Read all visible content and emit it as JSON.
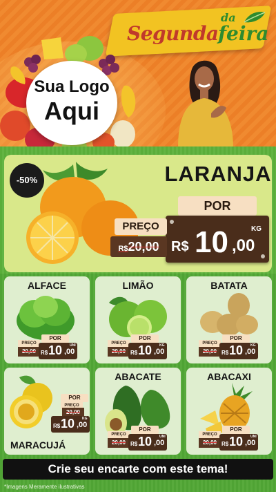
{
  "header": {
    "banner_part1": "Segunda",
    "banner_part2": "da",
    "banner_part3": "feira",
    "logo_line1": "Sua Logo",
    "logo_line2": "Aqui"
  },
  "hero": {
    "discount": "-50%",
    "product": "LARANJA",
    "por_label": "POR",
    "preco_label": "PREÇO",
    "old_currency": "R$",
    "old_price": "20,00",
    "currency": "R$",
    "price_int": "10",
    "price_dec": ",00",
    "unit": "KG"
  },
  "products": [
    {
      "name": "ALFACE",
      "preco_label": "PREÇO",
      "por_label": "POR",
      "old_price": "20,00",
      "currency": "R$",
      "price_int": "10",
      "price_dec": ",00",
      "unit": "UNI"
    },
    {
      "name": "LIMÃO",
      "preco_label": "PREÇO",
      "por_label": "POR",
      "old_price": "20,00",
      "currency": "R$",
      "price_int": "10",
      "price_dec": ",00",
      "unit": "KG"
    },
    {
      "name": "BATATA",
      "preco_label": "PREÇO",
      "por_label": "POR",
      "old_price": "20,00",
      "currency": "R$",
      "price_int": "10",
      "price_dec": ",00",
      "unit": "KG"
    },
    {
      "name": "MARACUJÁ",
      "preco_label": "PREÇO",
      "por_label": "POR",
      "old_price": "20,00",
      "currency": "R$",
      "price_int": "10",
      "price_dec": ",00",
      "unit": "KG"
    },
    {
      "name": "ABACATE",
      "preco_label": "PREÇO",
      "por_label": "POR",
      "old_price": "20,00",
      "currency": "R$",
      "price_int": "10",
      "price_dec": ",00",
      "unit": "UNI"
    },
    {
      "name": "ABACAXI",
      "preco_label": "PREÇO",
      "por_label": "POR",
      "old_price": "20,00",
      "currency": "R$",
      "price_int": "10",
      "price_dec": ",00",
      "unit": "UNI"
    }
  ],
  "cta": {
    "label": "Crie seu encarte com este tema!"
  },
  "footer": {
    "disclaimer": "*Imagens Meramente ilustrativas"
  },
  "colors": {
    "orange_bg": "#ec7f27",
    "green_bg": "#58aa3c",
    "banner_yellow": "#f2c322",
    "price_board": "#4a2d1b",
    "tag_cream": "#f7dfc2"
  }
}
